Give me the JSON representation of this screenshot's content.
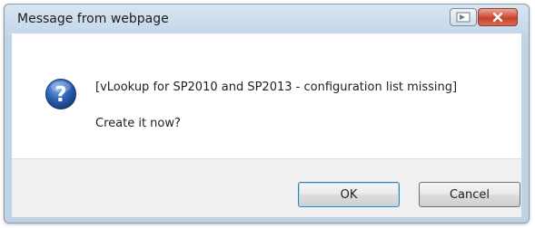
{
  "window": {
    "title": "Message from webpage"
  },
  "titlebar": {
    "help_icon": "help-icon",
    "close_icon": "close-icon"
  },
  "dialog": {
    "icon": "question-icon",
    "message": "[vLookup for SP2010 and SP2013 - configuration list missing]",
    "prompt": "Create it now?"
  },
  "buttons": {
    "ok_label": "OK",
    "cancel_label": "Cancel"
  },
  "colors": {
    "titlebar": "#c6d8ea",
    "close_button": "#c6412b",
    "icon_blue": "#2f63b5",
    "default_button_border": "#3c7fb1"
  }
}
